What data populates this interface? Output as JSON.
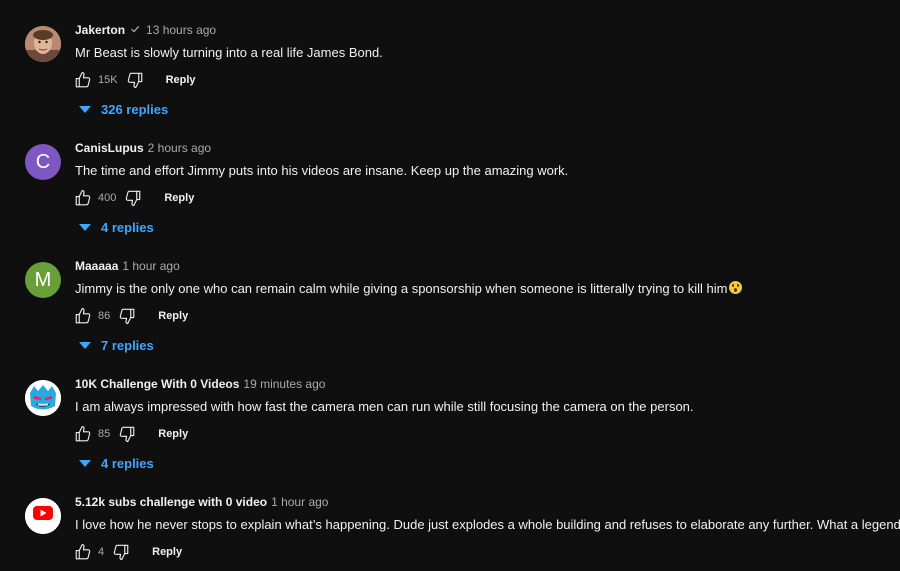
{
  "comments": [
    {
      "author": "Jakerton",
      "verified": true,
      "time": "13 hours ago",
      "text": "Mr Beast is slowly turning into a real life James Bond.",
      "likes": "15K",
      "reply_label": "Reply",
      "replies_label": "326 replies",
      "avatar": {
        "type": "photo",
        "icon": "face-photo-avatar"
      }
    },
    {
      "author": "CanisLupus",
      "verified": false,
      "time": "2 hours ago",
      "text": "The time and effort Jimmy puts into his videos are insane. Keep up the amazing work.",
      "likes": "400",
      "reply_label": "Reply",
      "replies_label": "4 replies",
      "avatar": {
        "type": "letter",
        "letter": "C",
        "color": "#7e57c2"
      }
    },
    {
      "author": "Maaaaa",
      "verified": false,
      "time": "1 hour ago",
      "text": "Jimmy is the only one who can remain calm while giving a sponsorship when someone is litterally trying to kill him",
      "emoji": "astonished-face-icon",
      "likes": "86",
      "reply_label": "Reply",
      "replies_label": "7 replies",
      "avatar": {
        "type": "letter",
        "letter": "M",
        "color": "#689f38"
      }
    },
    {
      "author": "10K Challenge With 0 Videos",
      "verified": false,
      "time": "19 minutes ago",
      "text": "I am always impressed with how fast the camera men can run while still focusing the camera on the person.",
      "likes": "85",
      "reply_label": "Reply",
      "replies_label": "4 replies",
      "avatar": {
        "type": "logo",
        "icon": "beast-logo-avatar",
        "color": "#2aa9e0"
      }
    },
    {
      "author": "5.12k subs challenge with 0 video",
      "verified": false,
      "time": "1 hour ago",
      "text": "I love how he never stops to explain what’s happening. Dude just explodes a whole building and refuses to elaborate any further. What a legend!",
      "likes": "4",
      "reply_label": "Reply",
      "replies_label": "",
      "avatar": {
        "type": "logo",
        "icon": "youtube-logo-avatar",
        "color": "#ff0000",
        "logo_text": "YouTube"
      }
    }
  ],
  "colors": {
    "background": "#0f0f0f",
    "text_primary": "#f1f1f1",
    "text_secondary": "#aaaaaa",
    "link_blue": "#3ea6ff"
  }
}
